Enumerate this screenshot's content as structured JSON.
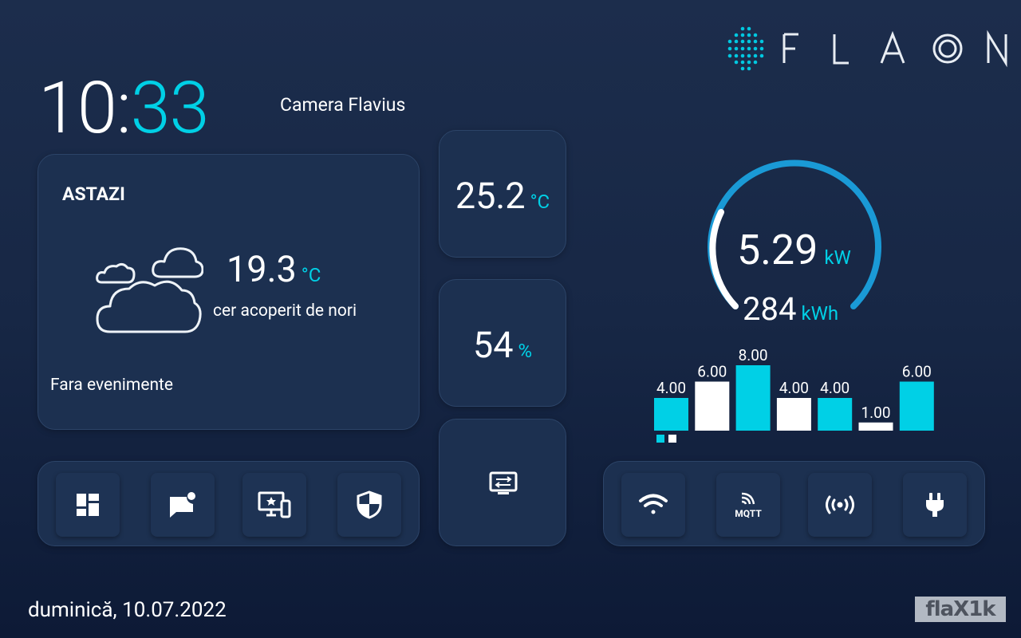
{
  "header": {
    "clock_hours": "10:",
    "clock_minutes": "33",
    "room": "Camera Flavius",
    "brand": "FLAON"
  },
  "weather": {
    "title": "ASTAZI",
    "temperature": "19.3",
    "temperature_unit": "°C",
    "description": "cer acoperit de nori",
    "events": "Fara evenimente",
    "icon": "cloudy-icon"
  },
  "sensors": {
    "temperature": "25.2",
    "temperature_unit": "°C",
    "humidity": "54",
    "humidity_unit": "%",
    "screen_icon": "screen-settings-icon"
  },
  "energy": {
    "power": "5.29",
    "power_unit": "kW",
    "energy": "284",
    "energy_unit": "kWh"
  },
  "chart_data": {
    "type": "bar",
    "values": [
      4.0,
      6.0,
      8.0,
      4.0,
      4.0,
      1.0,
      6.0
    ],
    "labels": [
      "4.00",
      "6.00",
      "8.00",
      "4.00",
      "4.00",
      "1.00",
      "6.00"
    ],
    "bar_colors": [
      "#00d0e6",
      "#ffffff",
      "#00d0e6",
      "#ffffff",
      "#00d0e6",
      "#ffffff",
      "#00d0e6"
    ],
    "ylim": [
      0,
      8
    ]
  },
  "actions_left": [
    {
      "name": "dashboard-icon"
    },
    {
      "name": "notification-message-icon"
    },
    {
      "name": "devices-icon"
    },
    {
      "name": "security-shield-icon"
    }
  ],
  "actions_right": [
    {
      "name": "wifi-icon"
    },
    {
      "name": "mqtt-icon",
      "label": "MQTT"
    },
    {
      "name": "broadcast-icon"
    },
    {
      "name": "power-plug-icon"
    }
  ],
  "footer": {
    "date": "duminică, 10.07.2022",
    "watermark": "flaX1k"
  },
  "colors": {
    "accent": "#00d0e6",
    "gauge_arc": "#1a9ad6",
    "card": "#1c3050"
  }
}
